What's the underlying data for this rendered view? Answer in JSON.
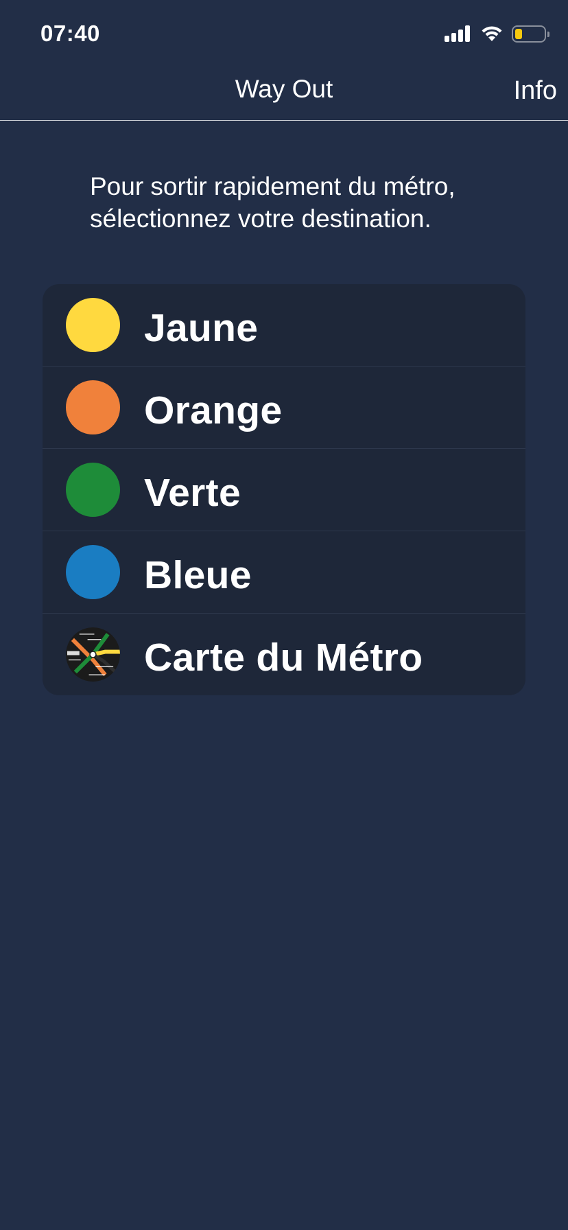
{
  "status_bar": {
    "time": "07:40",
    "battery_color": "#f6c90e"
  },
  "nav": {
    "title": "Way Out",
    "info_label": "Info"
  },
  "intro": {
    "text": "Pour sortir rapidement du métro, sélectionnez votre destination."
  },
  "lines": [
    {
      "label": "Jaune",
      "color": "#ffd93f"
    },
    {
      "label": "Orange",
      "color": "#f0813b"
    },
    {
      "label": "Verte",
      "color": "#1e8c39"
    },
    {
      "label": "Bleue",
      "color": "#1a7dc2"
    },
    {
      "label": "Carte du Métro",
      "icon": "metro-map-icon"
    }
  ],
  "colors": {
    "background": "#222e47",
    "list_background": "#1e2739",
    "text": "#ffffff"
  }
}
